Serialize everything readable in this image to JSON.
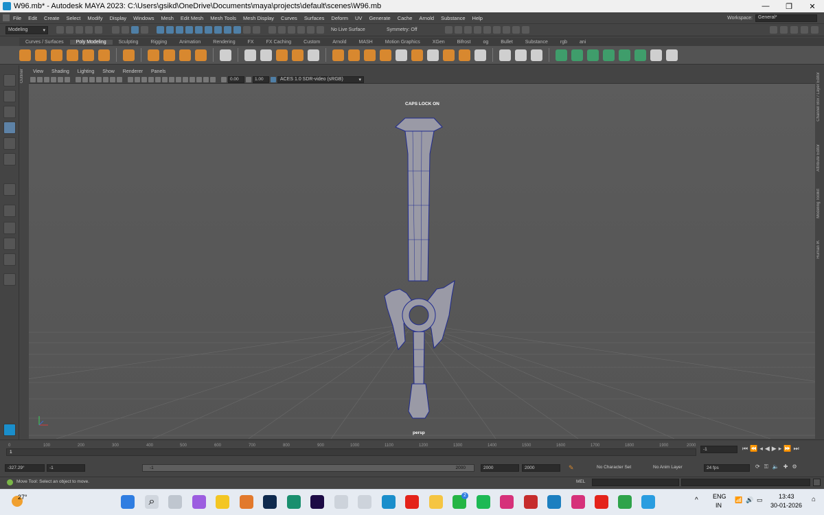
{
  "window": {
    "title": "W96.mb* - Autodesk MAYA 2023: C:\\Users\\gsikd\\OneDrive\\Documents\\maya\\projects\\default\\scenes\\W96.mb",
    "controls": [
      "—",
      "❐",
      "✕"
    ]
  },
  "menu": {
    "items": [
      "File",
      "Edit",
      "Create",
      "Select",
      "Modify",
      "Display",
      "Windows",
      "Mesh",
      "Edit Mesh",
      "Mesh Tools",
      "Mesh Display",
      "Curves",
      "Surfaces",
      "Deform",
      "UV",
      "Generate",
      "Cache",
      "Arnold",
      "Substance",
      "Help"
    ],
    "workspace_label": "Workspace:",
    "workspace_value": "General*"
  },
  "statusline": {
    "mode": "Modeling",
    "live_surface": "No Live Surface",
    "symmetry": "Symmetry: Off"
  },
  "shelf": {
    "tabs": [
      "Curves / Surfaces",
      "Poly Modeling",
      "Sculpting",
      "Rigging",
      "Animation",
      "Rendering",
      "FX",
      "FX Caching",
      "Custom",
      "Arnold",
      "MASH",
      "Motion Graphics",
      "XGen",
      "Bifrost",
      "og",
      "Bullet",
      "Substance",
      "rgb",
      "ani"
    ],
    "active_tab": "Poly Modeling"
  },
  "viewport": {
    "menu": [
      "View",
      "Shading",
      "Lighting",
      "Show",
      "Renderer",
      "Panels"
    ],
    "exposure": "0.00",
    "gamma": "1.00",
    "colorspace": "ACES 1.0 SDR-video (sRGB)",
    "caps_lock": "CAPS LOCK ON",
    "camera": "persp"
  },
  "side_tabs": {
    "outliner": "Outliner",
    "right": [
      "Channel Box / Layer Editor",
      "Attribute Editor",
      "Modeling Toolkit",
      "Human IK"
    ]
  },
  "timeline": {
    "ticks": [
      "0",
      "100",
      "200",
      "300",
      "400",
      "500",
      "600",
      "700",
      "800",
      "900",
      "1000",
      "1100",
      "1200",
      "1300",
      "1400",
      "1500",
      "1600",
      "1700",
      "1800",
      "1900",
      "2000"
    ],
    "current_marker": "1",
    "current_frame": "-1"
  },
  "range": {
    "angle": "-327.29°",
    "start": "-1",
    "slider_start": "-1",
    "slider_end": "2000",
    "end1": "2000",
    "end2": "2000",
    "char_set": "No Character Set",
    "anim_layer": "No Anim Layer",
    "fps": "24 fps"
  },
  "cmdline": {
    "lang": "MEL",
    "help": "Move Tool: Select an object to move."
  },
  "taskbar": {
    "weather": "27°",
    "lang1": "ENG",
    "lang2": "IN",
    "time": "13:43",
    "date": "30-01-2026",
    "badge": "2"
  }
}
